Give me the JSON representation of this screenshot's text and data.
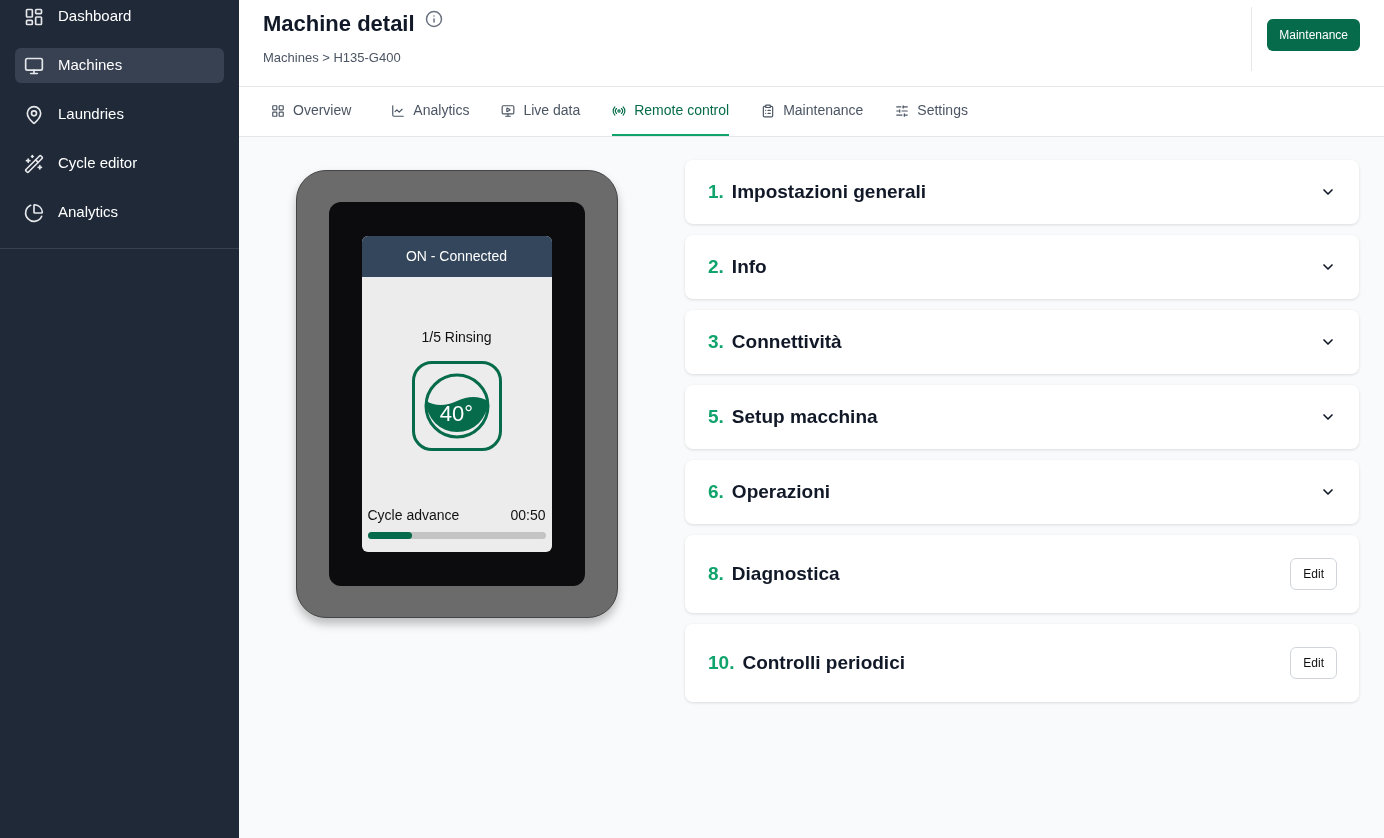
{
  "sidebar": {
    "items": [
      {
        "label": "Dashboard",
        "selected": false
      },
      {
        "label": "Machines",
        "selected": true
      },
      {
        "label": "Laundries",
        "selected": false
      },
      {
        "label": "Cycle editor",
        "selected": false
      },
      {
        "label": "Analytics",
        "selected": false
      }
    ]
  },
  "header": {
    "title": "Machine detail",
    "breadcrumb": "Machines > H135-G400",
    "button": "Maintenance"
  },
  "tabs": [
    {
      "label": "Overview",
      "selected": false
    },
    {
      "label": "Analytics",
      "selected": false
    },
    {
      "label": "Live data",
      "selected": false
    },
    {
      "label": "Remote control",
      "selected": true
    },
    {
      "label": "Maintenance",
      "selected": false
    },
    {
      "label": "Settings",
      "selected": false
    }
  ],
  "device": {
    "status": "ON - Connected",
    "step": "1/5 Rinsing",
    "temperature": "40°",
    "progress_label": "Cycle advance",
    "time": "00:50",
    "level": 0.25
  },
  "sections": [
    {
      "number": "1.",
      "title": "Impostazioni generali",
      "kind": "expandable"
    },
    {
      "number": "2.",
      "title": "Info",
      "kind": "expandable"
    },
    {
      "number": "3.",
      "title": "Connettività",
      "kind": "expandable"
    },
    {
      "number": "5.",
      "title": "Setup macchina",
      "kind": "expandable"
    },
    {
      "number": "6.",
      "title": "Operazioni",
      "kind": "expandable"
    },
    {
      "number": "8.",
      "title": "Diagnostica",
      "kind": "editable",
      "action": "Edit"
    },
    {
      "number": "10.",
      "title": "Controlli periodici",
      "kind": "editable",
      "action": "Edit"
    }
  ]
}
